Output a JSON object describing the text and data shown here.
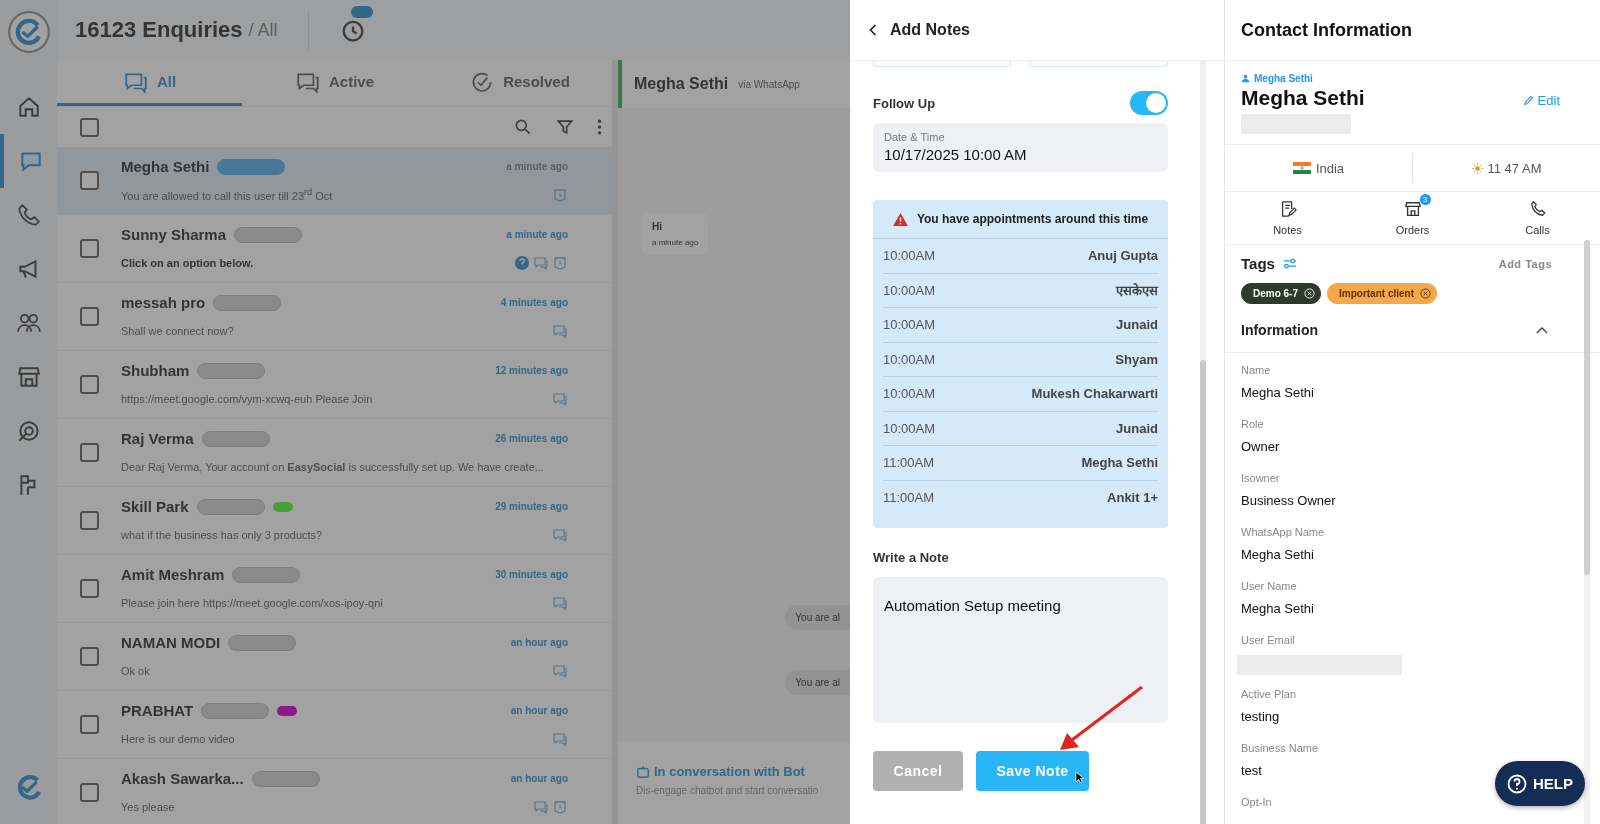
{
  "inbox": {
    "title": "16123 Enquiries",
    "filter": "/ All",
    "tabs": [
      {
        "label": "All",
        "selected": true
      },
      {
        "label": "Active",
        "selected": false
      },
      {
        "label": "Resolved",
        "selected": false
      }
    ],
    "select_all": {
      "checked": false
    },
    "conversations": [
      {
        "name": "Megha Sethi",
        "preview": "You are allowed to call this user till 23$^{rd}$ Oct",
        "time": "a minute ago",
        "selected": true,
        "checked": false,
        "unread": false,
        "has_question": false,
        "has_chat": false,
        "has_reminder": true
      },
      {
        "name": "Sunny Sharma",
        "preview": "Click on an option below.",
        "time": "a minute ago",
        "selected": false,
        "checked": false,
        "unread": true,
        "has_question": true,
        "has_chat": true,
        "has_reminder": true
      },
      {
        "name": "messah pro",
        "preview": "Shall we connect now?",
        "time": "4 minutes ago",
        "selected": false,
        "checked": false,
        "unread": false,
        "has_question": false,
        "has_chat": true,
        "has_reminder": false
      },
      {
        "name": "Shubham",
        "preview": "https://meet.google.com/vym-xcwq-euh Please Join",
        "time": "12 minutes ago",
        "selected": false,
        "checked": false,
        "unread": false,
        "has_question": false,
        "has_chat": true,
        "has_reminder": false
      },
      {
        "name": "Raj Verma",
        "preview": "Dear Raj Verma, Your account on **EasySocial** is successfully set up. We have create...",
        "time": "26 minutes ago",
        "selected": false,
        "checked": false,
        "unread": false,
        "has_question": false,
        "has_chat": false,
        "has_reminder": false
      },
      {
        "name": "Skill Park",
        "preview": "what if the business has only 3 products?",
        "time": "29 minutes ago",
        "selected": false,
        "checked": false,
        "unread": false,
        "color": "#4a9e3a",
        "has_question": false,
        "has_chat": true,
        "has_reminder": false
      },
      {
        "name": "Amit Meshram",
        "preview": "Please join here https://meet.google.com/xos-ipoy-qni",
        "time": "30 minutes ago",
        "selected": false,
        "checked": false,
        "unread": false,
        "has_question": false,
        "has_chat": true,
        "has_reminder": false
      },
      {
        "name": "NAMAN MODI",
        "preview": "Ok ok",
        "time": "an hour ago",
        "selected": false,
        "checked": false,
        "unread": false,
        "has_question": false,
        "has_chat": true,
        "has_reminder": false
      },
      {
        "name": "PRABHAT",
        "preview": "Here is our demo video",
        "time": "an hour ago",
        "selected": false,
        "checked": false,
        "unread": false,
        "color": "#8b1a8b",
        "has_question": false,
        "has_chat": true,
        "has_reminder": false
      },
      {
        "name": "Akash Sawarka...",
        "preview": "Yes please",
        "time": "an hour ago",
        "selected": false,
        "checked": false,
        "unread": false,
        "has_question": false,
        "has_chat": true,
        "has_reminder": true
      }
    ]
  },
  "chat": {
    "contact": "Megha Sethi",
    "channel": "via WhatsApp",
    "messages": [
      {
        "text": "Hi",
        "time": "a minute ago",
        "kind": "incoming"
      },
      {
        "text": "You are al",
        "kind": "outgoing"
      },
      {
        "text": "You are al",
        "kind": "outgoing"
      }
    ],
    "bot_banner": {
      "title": "In conversation with Bot",
      "text": "Dis-engage chatbot and start conversatio"
    }
  },
  "notes": {
    "title": "Add Notes",
    "follow_up": {
      "label": "Follow Up",
      "on": true
    },
    "date_field": {
      "label": "Date & Time",
      "value": "10/17/2025 10:00 AM"
    },
    "warning": "You have appointments around this time",
    "appointments": [
      {
        "time": "10:00AM",
        "name": "Anuj Gupta"
      },
      {
        "time": "10:00AM",
        "name": "एसकेएस"
      },
      {
        "time": "10:00AM",
        "name": "Junaid"
      },
      {
        "time": "10:00AM",
        "name": "Shyam"
      },
      {
        "time": "10:00AM",
        "name": "Mukesh Chakarwarti"
      },
      {
        "time": "10:00AM",
        "name": "Junaid"
      },
      {
        "time": "11:00AM",
        "name": "Megha Sethi"
      },
      {
        "time": "11:00AM",
        "name": "Ankit 1+"
      }
    ],
    "note": {
      "label": "Write a Note",
      "value": "Automation Setup meeting"
    },
    "buttons": [
      {
        "label": "Cancel",
        "kind": "secondary"
      },
      {
        "label": "Save Note",
        "kind": "primary"
      }
    ]
  },
  "contact": {
    "title": "Contact Information",
    "contact_label": "Megha Sethi",
    "name": "Megha Sethi",
    "edit": "Edit",
    "phone_redacted": true,
    "country": "India",
    "local_time": "11 47 AM",
    "actions": [
      {
        "label": "Notes"
      },
      {
        "label": "Orders",
        "badge": "3"
      },
      {
        "label": "Calls"
      }
    ],
    "tags_title": "Tags",
    "add_tags": "Add Tags",
    "tags": [
      {
        "label": "Demo 6-7",
        "color": "#2e3b2c"
      },
      {
        "label": "Important client",
        "color": "#f5a84a"
      }
    ],
    "info": {
      "title": "Information",
      "expanded": true,
      "fields": [
        {
          "label": "Name",
          "value": "Megha Sethi"
        },
        {
          "label": "Role",
          "value": "Owner"
        },
        {
          "label": "Isowner",
          "value": "Business Owner"
        },
        {
          "label": "WhatsApp Name",
          "value": "Megha Sethi"
        },
        {
          "label": "User Name",
          "value": "Megha Sethi"
        },
        {
          "label": "User Email",
          "redacted": true
        },
        {
          "label": "Active Plan",
          "value": "testing"
        },
        {
          "label": "Business Name",
          "value": "test"
        },
        {
          "label": "Opt-In"
        }
      ]
    }
  },
  "help": "HELP"
}
